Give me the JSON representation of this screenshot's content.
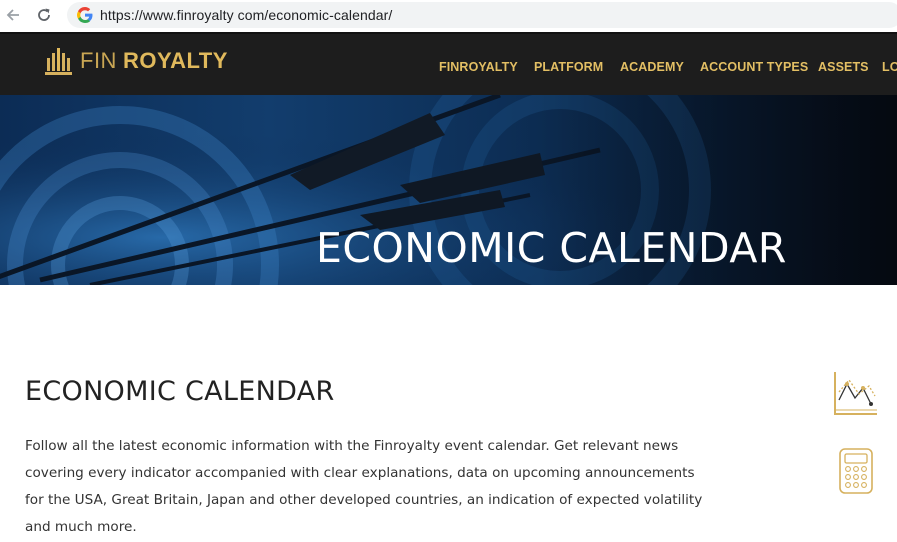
{
  "browser": {
    "back_icon": "arrow-left-icon",
    "reload_icon": "reload-icon",
    "favicon": "google-g-icon",
    "url": "https://www.finroyalty com/economic-calendar/"
  },
  "header": {
    "logo_fin": "FIN",
    "logo_royalty": "ROYALTY",
    "brand_color": "#e0b95c",
    "nav": [
      {
        "label": "FINROYALTY"
      },
      {
        "label": "PLATFORM"
      },
      {
        "label": "ACADEMY"
      },
      {
        "label": "ACCOUNT TYPES"
      },
      {
        "label": "ASSETS"
      },
      {
        "label": "LO"
      }
    ]
  },
  "hero": {
    "title": "ECONOMIC CALENDAR"
  },
  "content": {
    "title": "ECONOMIC CALENDAR",
    "body": "Follow all the latest economic information with the Finroyalty event calendar. Get relevant news covering every indicator accompanied with clear explanations, data on upcoming announcements for the USA, Great Britain, Japan and other developed countries, an indication of expected volatility and much more."
  },
  "side_icons": [
    "chart-icon",
    "calculator-icon"
  ]
}
